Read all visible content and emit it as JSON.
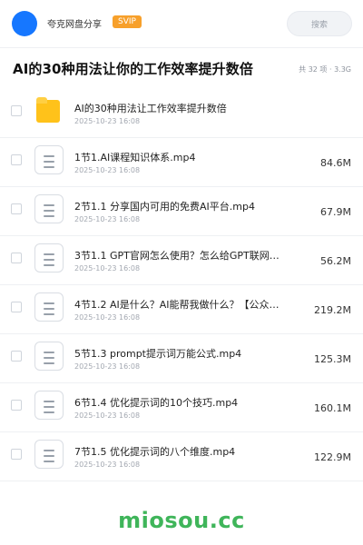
{
  "header": {
    "brand": "夸克网盘分享",
    "badge": "SVIP",
    "search_placeholder": "搜索"
  },
  "title": {
    "text": "AI的30种用法让你的工作效率提升数倍",
    "meta": "共 32 项 · 3.3G"
  },
  "items": [
    {
      "type": "folder",
      "name": "AI的30种用法让工作效率提升数倍",
      "date": "2025-10-23 16:08",
      "size": ""
    },
    {
      "type": "file",
      "name": "1节1.AI课程知识体系.mp4",
      "date": "2025-10-23 16:08",
      "size": "84.6M"
    },
    {
      "type": "file",
      "name": "2节1.1 分享国内可用的免费AI平台.mp4",
      "date": "2025-10-23 16:08",
      "size": "67.9M"
    },
    {
      "type": "file",
      "name": "3节1.1 GPT官网怎么使用？怎么给GPT联网？...",
      "date": "2025-10-23 16:08",
      "size": "56.2M"
    },
    {
      "type": "file",
      "name": "4节1.2 AI是什么？AI能帮我做什么？【公众号...",
      "date": "2025-10-23 16:08",
      "size": "219.2M"
    },
    {
      "type": "file",
      "name": "5节1.3 prompt提示词万能公式.mp4",
      "date": "2025-10-23 16:08",
      "size": "125.3M"
    },
    {
      "type": "file",
      "name": "6节1.4 优化提示词的10个技巧.mp4",
      "date": "2025-10-23 16:08",
      "size": "160.1M"
    },
    {
      "type": "file",
      "name": "7节1.5 优化提示词的八个维度.mp4",
      "date": "2025-10-23 16:08",
      "size": "122.9M"
    }
  ],
  "footer": {
    "watermark": "miosou.cc"
  }
}
